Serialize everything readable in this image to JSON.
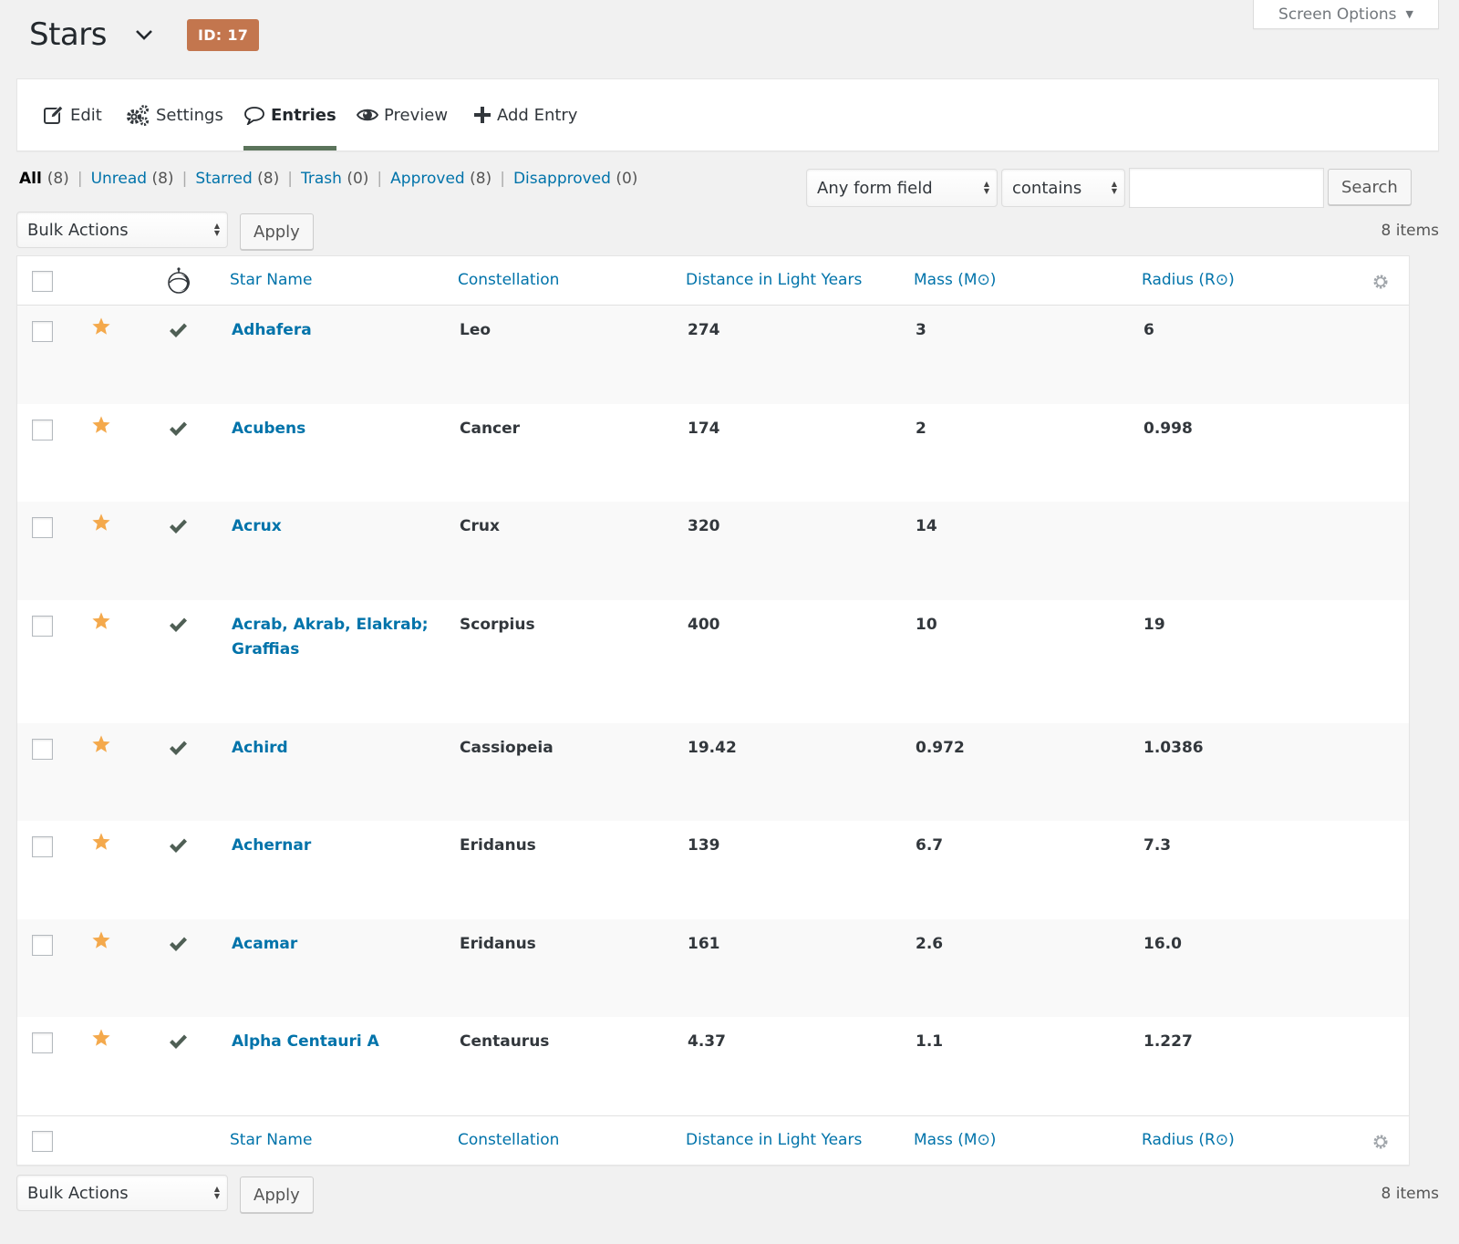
{
  "header": {
    "title": "Stars",
    "id_badge": "ID: 17",
    "screen_options": "Screen Options"
  },
  "toolbar": {
    "items": [
      {
        "label": "Edit",
        "icon": "edit-icon"
      },
      {
        "label": "Settings",
        "icon": "gears-icon"
      },
      {
        "label": "Entries",
        "icon": "comment-icon",
        "active": true
      },
      {
        "label": "Preview",
        "icon": "eye-icon"
      },
      {
        "label": "Add Entry",
        "icon": "plus-icon"
      }
    ]
  },
  "filters": [
    {
      "label": "All",
      "count": "(8)",
      "current": true
    },
    {
      "label": "Unread",
      "count": "(8)"
    },
    {
      "label": "Starred",
      "count": "(8)"
    },
    {
      "label": "Trash",
      "count": "(0)"
    },
    {
      "label": "Approved",
      "count": "(8)"
    },
    {
      "label": "Disapproved",
      "count": "(0)"
    }
  ],
  "search": {
    "field_select": "Any form field",
    "operator_select": "contains",
    "value": "",
    "button": "Search"
  },
  "tablenav": {
    "bulk_actions": "Bulk Actions",
    "apply": "Apply",
    "items_count": "8 items"
  },
  "table": {
    "columns": [
      "Star Name",
      "Constellation",
      "Distance in Light Years",
      "Mass (M⊙)",
      "Radius (R⊙)"
    ],
    "rows": [
      {
        "name": "Adhafera",
        "constellation": "Leo",
        "distance": "274",
        "mass": "3",
        "radius": "6",
        "starred": true,
        "approved": true
      },
      {
        "name": "Acubens",
        "constellation": "Cancer",
        "distance": "174",
        "mass": "2",
        "radius": "0.998",
        "starred": true,
        "approved": true
      },
      {
        "name": "Acrux",
        "constellation": "Crux",
        "distance": "320",
        "mass": "14",
        "radius": "",
        "starred": true,
        "approved": true
      },
      {
        "name": "Acrab, Akrab, Elakrab; Graffias",
        "constellation": "Scorpius",
        "distance": "400",
        "mass": "10",
        "radius": "19",
        "starred": true,
        "approved": true
      },
      {
        "name": "Achird",
        "constellation": "Cassiopeia",
        "distance": "19.42",
        "mass": "0.972",
        "radius": "1.0386",
        "starred": true,
        "approved": true
      },
      {
        "name": "Achernar",
        "constellation": "Eridanus",
        "distance": "139",
        "mass": "6.7",
        "radius": "7.3",
        "starred": true,
        "approved": true
      },
      {
        "name": "Acamar",
        "constellation": "Eridanus",
        "distance": "161",
        "mass": "2.6",
        "radius": "16.0",
        "starred": true,
        "approved": true
      },
      {
        "name": "Alpha Centauri A",
        "constellation": "Centaurus",
        "distance": "4.37",
        "mass": "1.1",
        "radius": "1.227",
        "starred": true,
        "approved": true
      }
    ]
  },
  "colors": {
    "link": "#0073aa",
    "badge": "#c3764e",
    "star": "#f4a94c",
    "check": "#4f5f55",
    "active_tab": "#5b745b"
  }
}
